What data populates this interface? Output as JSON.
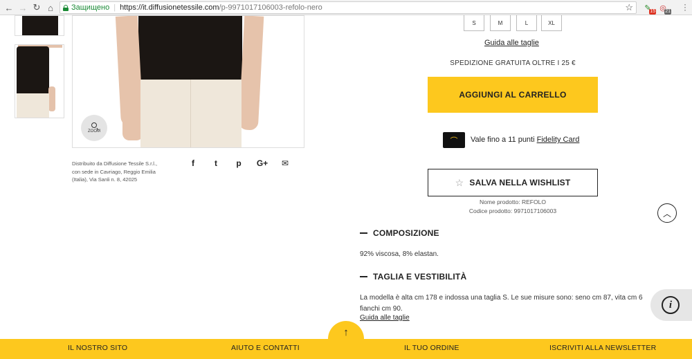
{
  "browser": {
    "back_icon": "back-arrow-icon",
    "forward_icon": "forward-arrow-icon",
    "reload_icon": "reload-icon",
    "home_icon": "home-icon",
    "secure_label": "Защищено",
    "url_host": "https://it.diffusionetessile.com",
    "url_path": "/p-9971017106003-refolo-nero",
    "ext1_badge": "15",
    "ext2_badge": "21"
  },
  "sizes": [
    "S",
    "M",
    "L",
    "XL"
  ],
  "size_guide": "Guida alle taglie",
  "zoom_label": "ZOOM",
  "distributor": "Distribuito da Diffusione Tessile S.r.l., con sede in Cavriago, Reggio Emilia (Italia), Via Sanli n. 8, 42025",
  "share": {
    "facebook": "f",
    "twitter": "t",
    "pinterest": "p",
    "google": "G+",
    "email": "✉"
  },
  "shipping": "SPEDIZIONE GRATUITA OLTRE I 25 €",
  "cart_button": "AGGIUNGI AL CARRELLO",
  "fidelity": {
    "prefix": "Vale fino a 11 punti ",
    "link": "Fidelity Card"
  },
  "wishlist_button": "SALVA NELLA WISHLIST",
  "product_name": "Nome prodotto:  REFOLO",
  "product_code": "Codice prodotto:  9971017106003",
  "composition": {
    "title": "COMPOSIZIONE",
    "text": "92% viscosa, 8% elastan."
  },
  "fit": {
    "title": "TAGLIA E VESTIBILITÀ",
    "line1": "La modella è alta cm 178 e indossa una taglia S. Le sue misure sono: seno cm 87, vita cm 6",
    "line2": "fianchi cm 90.",
    "guide": "Guida alle taglie"
  },
  "footer": {
    "site": "IL NOSTRO SITO",
    "help": "AIUTO E CONTATTI",
    "order": "IL TUO ORDINE",
    "newsletter": "ISCRIVITI ALLA NEWSLETTER"
  },
  "colors": {
    "accent": "#fdc81e",
    "shirt": "#1b1613",
    "skirt": "#efe7da",
    "secure": "#1a8a35"
  }
}
